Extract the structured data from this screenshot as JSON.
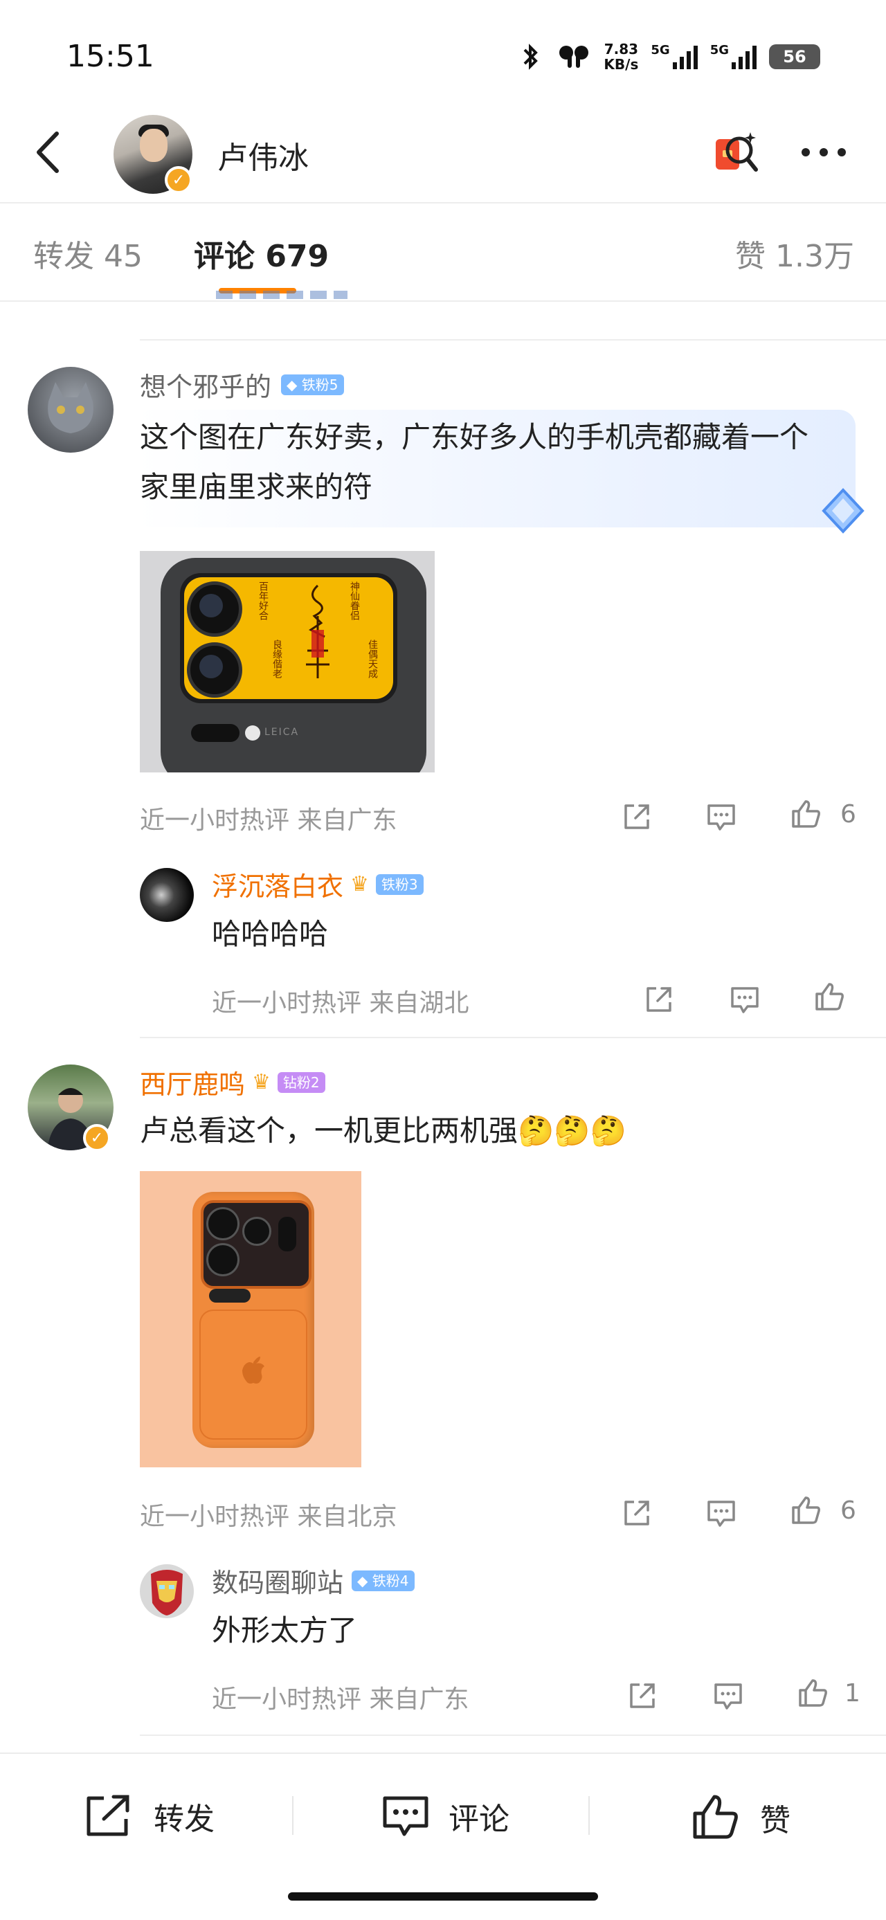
{
  "status_bar": {
    "time": "15:51",
    "speed_value": "7.83",
    "speed_unit": "KB/s",
    "net1": "5G",
    "net2": "5G",
    "battery": "56"
  },
  "header": {
    "name": "卢伟冰"
  },
  "tabs": {
    "repost": "转发 45",
    "comments": "评论 679",
    "likes": "赞 1.3万"
  },
  "comments": [
    {
      "user": "想个邪乎的",
      "badge": "铁粉5",
      "text": "这个图在广东好卖，广东好多人的手机壳都藏着一个家里庙里求来的符",
      "meta": "近一小时热评  来自广东",
      "likes": "6",
      "image_text": {
        "left_col": "百年好合",
        "left_col2": "良缘偕老",
        "right_col": "神仙眷侣",
        "right_col2": "佳偶天成",
        "brand": "LEICA"
      },
      "reply": {
        "user": "浮沉落白衣",
        "badge": "铁粉3",
        "text": "哈哈哈哈",
        "meta": "近一小时热评  来自湖北"
      }
    },
    {
      "user": "西厅鹿鸣",
      "badge": "钻粉2",
      "text": "卢总看这个，一机更比两机强🤔🤔🤔",
      "meta": "近一小时热评  来自北京",
      "likes": "6",
      "reply": {
        "user": "数码圈聊站",
        "badge": "铁粉4",
        "text": "外形太方了",
        "meta": "近一小时热评  来自广东",
        "likes": "1"
      }
    }
  ],
  "bottom_bar": {
    "repost": "转发",
    "comment": "评论",
    "like": "赞"
  },
  "colors": {
    "accent": "#ff8200",
    "orange_name": "#f07000",
    "tiefen_badge": "#7cb9ff",
    "zuanfen_badge": "#c58cf5"
  }
}
